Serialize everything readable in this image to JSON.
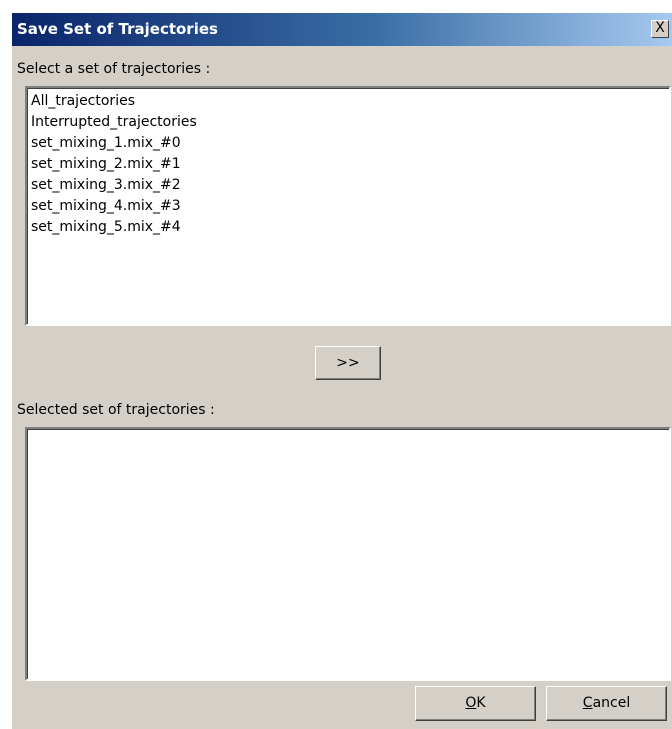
{
  "dialog": {
    "title": "Save Set of Trajectories",
    "close_glyph": "X",
    "close_icon": "close-icon"
  },
  "source": {
    "label": "Select a set of trajectories :",
    "items": [
      "All_trajectories",
      "Interrupted_trajectories",
      "set_mixing_1.mix_#0",
      "set_mixing_2.mix_#1",
      "set_mixing_3.mix_#2",
      "set_mixing_4.mix_#3",
      "set_mixing_5.mix_#4"
    ]
  },
  "move_button": {
    "label": ">>"
  },
  "selected": {
    "label": "Selected set of trajectories :",
    "items": []
  },
  "buttons": {
    "ok": {
      "accel": "O",
      "rest": "K"
    },
    "cancel": {
      "accel": "C",
      "rest": "ancel"
    }
  }
}
